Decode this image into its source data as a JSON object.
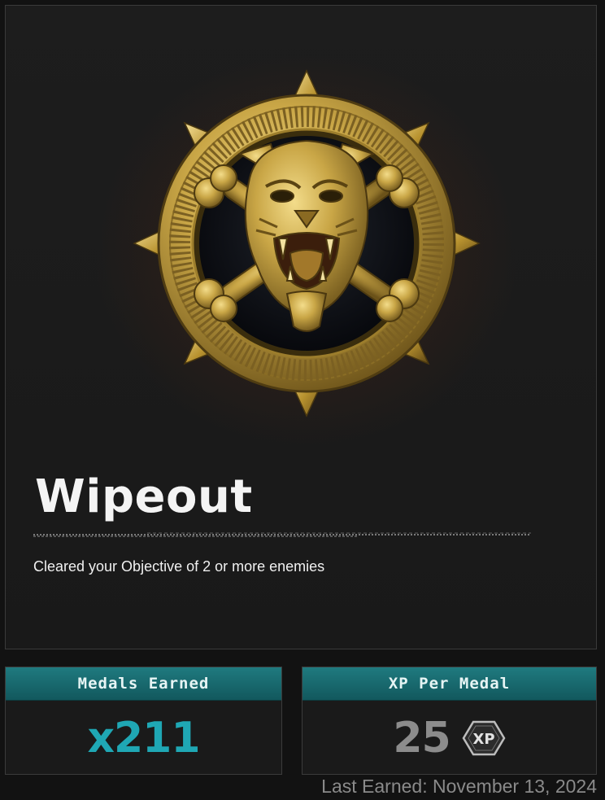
{
  "medal": {
    "icon": "tiger-crossbones-medal-icon",
    "title": "Wipeout",
    "description": "Cleared your Objective of 2 or more enemies"
  },
  "stats": {
    "medals_earned": {
      "label": "Medals Earned",
      "value": "x211"
    },
    "xp_per_medal": {
      "label": "XP Per Medal",
      "value": "25",
      "badge": "XP"
    }
  },
  "last_earned": "Last Earned: November 13, 2024",
  "colors": {
    "accent_teal": "#1fa7b4",
    "header_teal": "#1f7a7f",
    "gold": "#c9a646"
  }
}
